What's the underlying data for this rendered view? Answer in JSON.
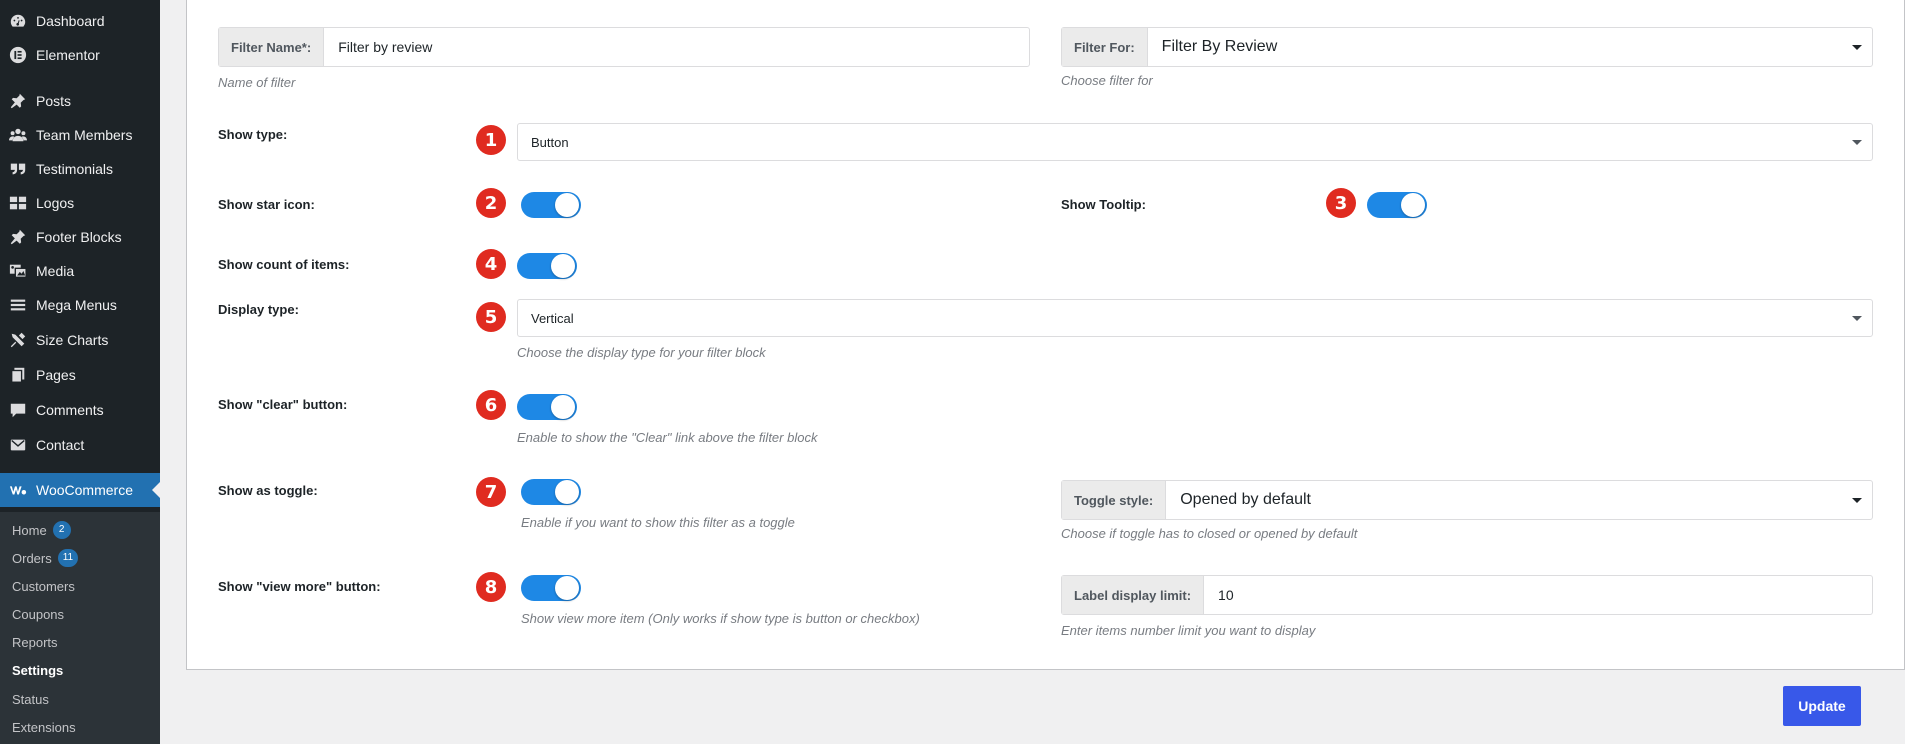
{
  "sidebar": {
    "items": [
      {
        "label": "Dashboard",
        "icon": "dashboard-icon"
      },
      {
        "label": "Elementor",
        "icon": "elementor-icon"
      },
      {
        "label": "Posts",
        "icon": "pin-icon"
      },
      {
        "label": "Team Members",
        "icon": "users-icon"
      },
      {
        "label": "Testimonials",
        "icon": "quote-icon"
      },
      {
        "label": "Logos",
        "icon": "grid-icon"
      },
      {
        "label": "Footer Blocks",
        "icon": "pin-icon"
      },
      {
        "label": "Media",
        "icon": "media-icon"
      },
      {
        "label": "Mega Menus",
        "icon": "menu-icon"
      },
      {
        "label": "Size Charts",
        "icon": "tools-icon"
      },
      {
        "label": "Pages",
        "icon": "pages-icon"
      },
      {
        "label": "Comments",
        "icon": "comment-icon"
      },
      {
        "label": "Contact",
        "icon": "mail-icon"
      }
    ],
    "woocommerce": {
      "label": "WooCommerce",
      "icon": "woo-icon"
    },
    "submenu": [
      {
        "label": "Home",
        "badge": "2"
      },
      {
        "label": "Orders",
        "badge": "11"
      },
      {
        "label": "Customers"
      },
      {
        "label": "Coupons"
      },
      {
        "label": "Reports"
      },
      {
        "label": "Settings"
      },
      {
        "label": "Status"
      },
      {
        "label": "Extensions"
      }
    ]
  },
  "form": {
    "filter_name": {
      "label": "Filter Name*:",
      "value": "Filter by review",
      "help": "Name of filter"
    },
    "filter_for": {
      "label": "Filter For:",
      "value": "Filter By Review",
      "help": "Choose filter for"
    },
    "show_type": {
      "label": "Show type:",
      "value": "Button",
      "marker": "1"
    },
    "show_star_icon": {
      "label": "Show star icon:",
      "enabled": true,
      "marker": "2"
    },
    "show_tooltip": {
      "label": "Show Tooltip:",
      "enabled": true,
      "marker": "3"
    },
    "show_count": {
      "label": "Show count of items:",
      "enabled": true,
      "marker": "4"
    },
    "display_type": {
      "label": "Display type:",
      "value": "Vertical",
      "help": "Choose the display type for your filter block",
      "marker": "5"
    },
    "show_clear": {
      "label": "Show \"clear\" button:",
      "enabled": true,
      "help": "Enable to show the \"Clear\" link above the filter block",
      "marker": "6"
    },
    "show_as_toggle": {
      "label": "Show as toggle:",
      "enabled": true,
      "help": "Enable if you want to show this filter as a toggle",
      "marker": "7"
    },
    "toggle_style": {
      "label": "Toggle style:",
      "value": "Opened by default",
      "help": "Choose if toggle has to closed or opened by default"
    },
    "show_view_more": {
      "label": "Show \"view more\" button:",
      "enabled": true,
      "help": "Show view more item (Only works if show type is button or checkbox)",
      "marker": "8"
    },
    "label_display_limit": {
      "label": "Label display limit:",
      "value": "10",
      "help": "Enter items number limit you want to display"
    }
  },
  "update_label": "Update",
  "colors": {
    "sidebar_bg": "#1d2327",
    "accent": "#2271b1",
    "toggle_on": "#1e88e5",
    "marker": "#e02b20",
    "update_button": "#3858e9"
  }
}
